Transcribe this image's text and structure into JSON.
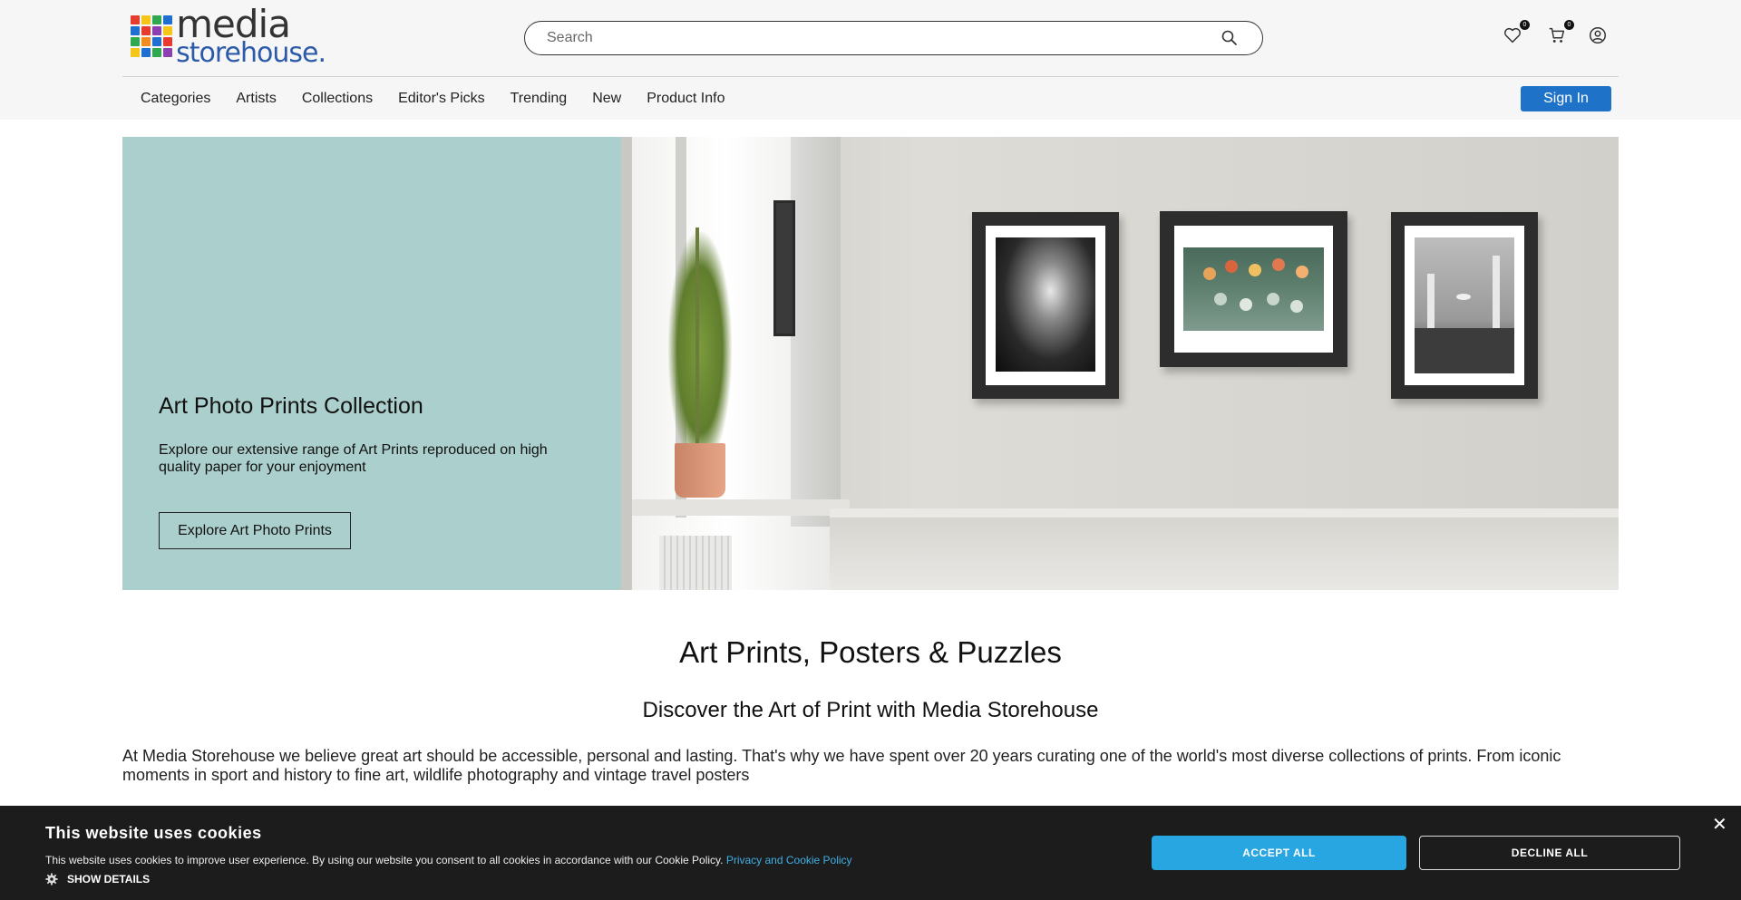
{
  "header": {
    "logo_line1": "media",
    "logo_line2": "storehouse.",
    "search_placeholder": "Search",
    "wishlist_count": "0",
    "cart_count": "0",
    "nav": [
      "Categories",
      "Artists",
      "Collections",
      "Editor's Picks",
      "Trending",
      "New",
      "Product Info"
    ],
    "signin_label": "Sign In",
    "accent_color": "#1e73c9"
  },
  "hero": {
    "title": "Art Photo Prints Collection",
    "text": "Explore our extensive range of Art Prints reproduced on high quality paper for your enjoyment",
    "button_label": "Explore Art Photo Prints",
    "panel_color": "#abcfcc"
  },
  "intro": {
    "title": "Art Prints, Posters & Puzzles",
    "subtitle": "Discover the Art of Print with Media Storehouse",
    "text": "At Media Storehouse we believe great art should be accessible, personal and lasting. That's why we have spent over 20 years curating one of the world's most diverse collections of prints. From iconic moments in sport and history to fine art, wildlife photography and vintage travel posters"
  },
  "cookie": {
    "title": "This website uses cookies",
    "text": "This website uses cookies to improve user experience. By using our website you consent to all cookies in accordance with our Cookie Policy.",
    "link_label": "Privacy and Cookie Policy",
    "details_label": "SHOW DETAILS",
    "accept_label": "ACCEPT ALL",
    "decline_label": "DECLINE ALL",
    "close_label": "✕",
    "accept_color": "#27a6e1"
  }
}
